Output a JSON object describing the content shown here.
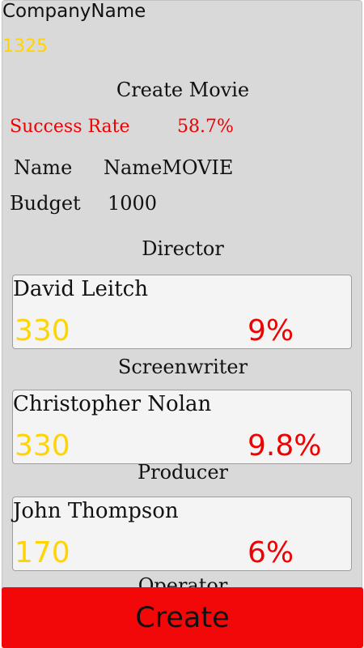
{
  "company": {
    "name": "CompanyName",
    "money": "1325"
  },
  "screen": {
    "title": "Create Movie"
  },
  "stats": {
    "success_label": "Success Rate",
    "success_value": "58.7%",
    "name_label": "Name",
    "name_value": "NameMOVIE",
    "budget_label": "Budget",
    "budget_value": "1000"
  },
  "crew": [
    {
      "role": "Director",
      "name": "David Leitch",
      "cost": "330",
      "rate": "9%"
    },
    {
      "role": "Screenwriter",
      "name": "Christopher Nolan",
      "cost": "330",
      "rate": "9.8%"
    },
    {
      "role": "Producer",
      "name": "John Thompson",
      "cost": "170",
      "rate": "6%"
    },
    {
      "role": "Operator"
    }
  ],
  "actions": {
    "create_label": "Create"
  },
  "colors": {
    "panel": "#d9d9d9",
    "money": "#ffd400",
    "accent_red": "#f00000",
    "button": "#f20808"
  }
}
